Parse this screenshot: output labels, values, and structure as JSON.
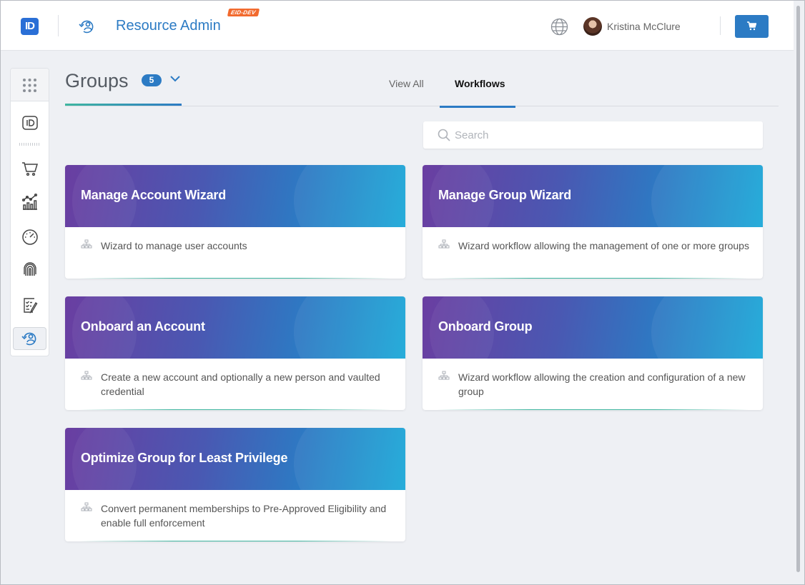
{
  "header": {
    "logo_text": "ID",
    "app_title": "Resource Admin",
    "env_badge": "EID-DEV",
    "user_name": "Kristina McClure"
  },
  "groups": {
    "title": "Groups",
    "count": "5"
  },
  "tabs": [
    {
      "label": "View All",
      "active": false
    },
    {
      "label": "Workflows",
      "active": true
    }
  ],
  "search": {
    "placeholder": "Search",
    "value": ""
  },
  "rail": {
    "items": [
      "grid-icon",
      "id-icon",
      "cart-icon",
      "analytics-icon",
      "gauge-icon",
      "fingerprint-icon",
      "checklist-icon",
      "resource-admin-icon"
    ],
    "active": "resource-admin-icon"
  },
  "colors": {
    "accent": "#2c7bc4",
    "env_badge": "#f26a2e",
    "banner_start": "#6a3ea1",
    "banner_end": "#1aa8d8"
  },
  "workflows": [
    {
      "title": "Manage Account Wizard",
      "description": "Wizard to manage user accounts"
    },
    {
      "title": "Manage Group Wizard",
      "description": "Wizard workflow allowing the management of one or more groups"
    },
    {
      "title": "Onboard an Account",
      "description": "Create a new account and optionally a new person and vaulted credential"
    },
    {
      "title": "Onboard Group",
      "description": "Wizard workflow allowing the creation and configuration of a new group"
    },
    {
      "title": "Optimize Group for Least Privilege",
      "description": "Convert permanent memberships to Pre-Approved Eligibility and enable full enforcement"
    }
  ]
}
